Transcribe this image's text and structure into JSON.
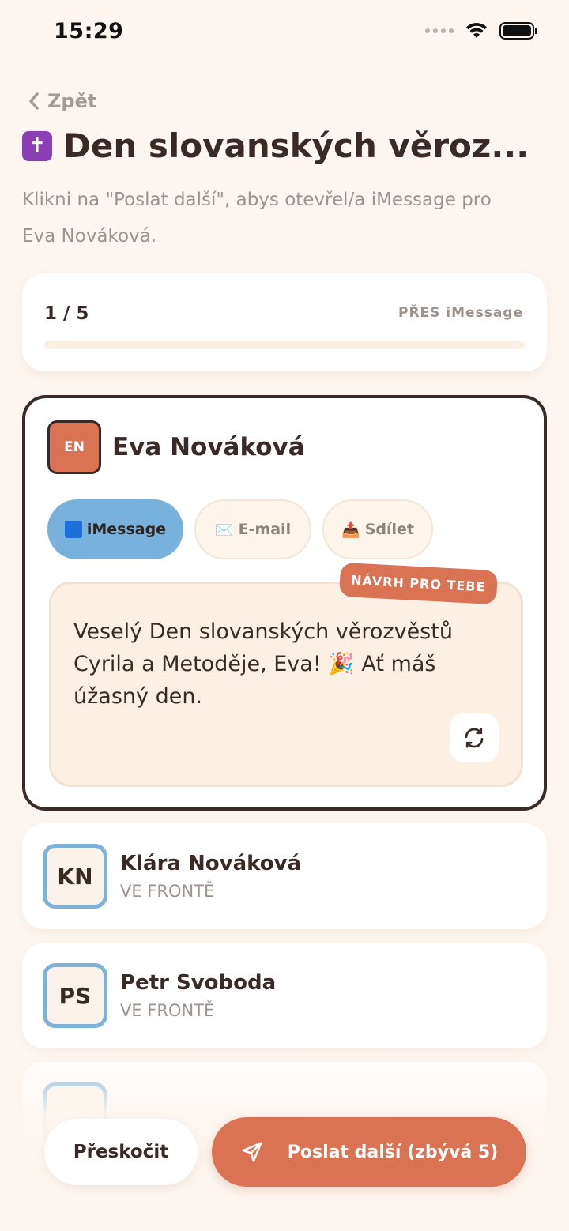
{
  "status_bar": {
    "time": "15:29"
  },
  "header": {
    "back_label": "Zpět",
    "title_emoji": "✝",
    "title": "Den slovanských věroz...",
    "subtitle": "Klikni na \"Poslat další\", abys otevřel/a iMessage pro Eva Nováková."
  },
  "progress": {
    "count_label": "1 / 5",
    "via_label": "PŘES iMessage",
    "fraction": 0.0
  },
  "active_recipient": {
    "initials": "EN",
    "name": "Eva Nováková",
    "channels": [
      {
        "label": "iMessage",
        "icon": "blue-square-icon",
        "selected": true
      },
      {
        "label": "E-mail",
        "icon": "✉️",
        "selected": false
      },
      {
        "label": "Sdílet",
        "icon": "📤",
        "selected": false
      }
    ],
    "suggestion_badge": "NÁVRH PRO TEBE",
    "message": "Veselý Den slovanských věrozvěstů Cyrila a Metoděje, Eva! 🎉 Ať máš úžasný den."
  },
  "queue": [
    {
      "initials": "KN",
      "name": "Klára Nováková",
      "status": "VE FRONTĚ"
    },
    {
      "initials": "PS",
      "name": "Petr Svoboda",
      "status": "VE FRONTĚ"
    }
  ],
  "actions": {
    "skip_label": "Přeskočit",
    "send_label": "Poslat další (zbývá 5)"
  },
  "colors": {
    "background": "#fdf6f0",
    "accent": "#d97354",
    "imessage_chip": "#78b2dc",
    "text_dark": "#3a2a26"
  }
}
